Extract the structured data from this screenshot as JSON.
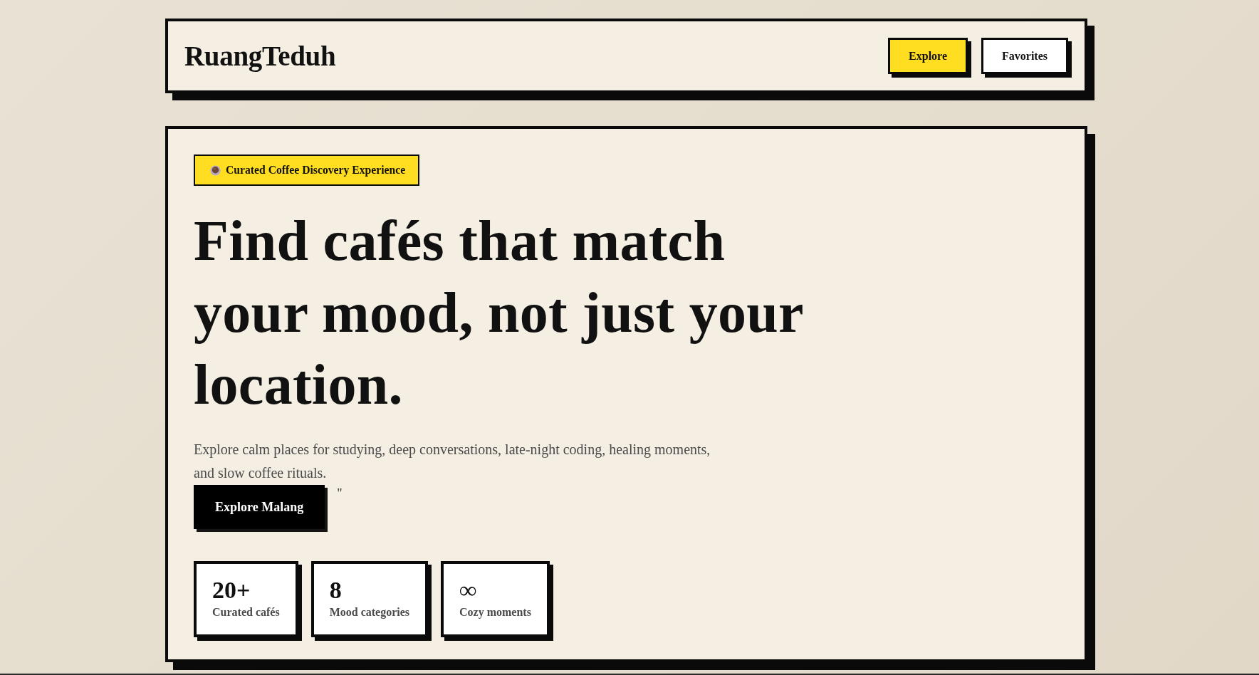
{
  "header": {
    "logo": "RuangTeduh",
    "nav": [
      {
        "label": "Explore",
        "kind": "primary"
      },
      {
        "label": "Favorites",
        "kind": "secondary"
      }
    ]
  },
  "hero": {
    "badge": {
      "text": "Curated Coffee Discovery Experience"
    },
    "title": "Find cafés that match your mood, not just your location.",
    "description": "Explore calm places for studying, deep conversations, late-night coding, healing moments, and slow coffee rituals.",
    "cta": {
      "label": "Explore Malang"
    },
    "stray_text": "\"",
    "stats": [
      {
        "value": "20+",
        "label": "Curated cafés"
      },
      {
        "value": "8",
        "label": "Mood categories"
      },
      {
        "value": "∞",
        "label": "Cozy moments"
      }
    ]
  }
}
